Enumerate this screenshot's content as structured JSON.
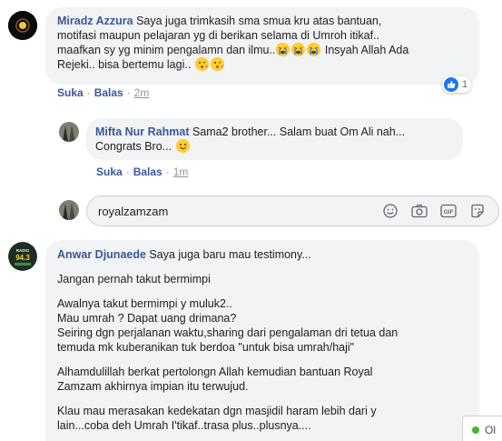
{
  "comments": [
    {
      "author": "Miradz Azzura",
      "text_line1": "Saya juga trimkasih sma smua kru atas bantuan,",
      "text_line2": "motifasi maupun pelajaran yg di berikan selama di Umroh itikaf..",
      "text_line3a": "maafkan sy yg minim pengalamn dan ilmu..",
      "text_line3b": "Insyah Allah Ada",
      "text_line4": "Rejeki.. bisa bertemu lagi..",
      "actions": {
        "like": "Suka",
        "reply": "Balas",
        "time": "2m"
      },
      "reaction_count": "1",
      "reaction_icon": "thumbs-up-icon",
      "replies": [
        {
          "author": "Mifta Nur Rahmat",
          "text_line1": "Sama2 brother... Salam buat Om Ali nah...",
          "text_line2": "Congrats Bro...",
          "actions": {
            "like": "Suka",
            "reply": "Balas",
            "time": "1m"
          }
        }
      ]
    },
    {
      "author": "Anwar Djunaede",
      "text_line1": "Saya juga baru mau testimony...",
      "paragraphs": [
        [
          "Jangan pernah takut bermimpi"
        ],
        [
          "Awalnya takut bermimpi y muluk2..",
          "Mau umrah ? Dapat uang drimana?",
          "Seiring dgn perjalanan waktu,sharing dari pengalaman dri tetua dan",
          "temuda mk kuberanikan tuk berdoa \"untuk bisa umrah/haji\""
        ],
        [
          "Alhamdulillah berkat pertolongn Allah kemudian bantuan Royal",
          "Zamzam akhirnya impian itu terwujud."
        ],
        [
          "Klau mau merasakan kedekatan dgn masjidil haram lebih dari y",
          "lain...coba deh Umrah I'tikaf..trasa plus..plusnya...."
        ]
      ],
      "avatar_text": "RADIO",
      "avatar_number": "94.3"
    }
  ],
  "reply_input": {
    "value": "royalzamzam",
    "icons": [
      "emoji-icon",
      "camera-icon",
      "gif-icon",
      "sticker-icon"
    ]
  },
  "chat_tab": {
    "label": "Ol"
  },
  "colors": {
    "link": "#385898",
    "bubble": "#f2f3f5",
    "like_blue": "#1877f2",
    "online": "#42b72a"
  }
}
